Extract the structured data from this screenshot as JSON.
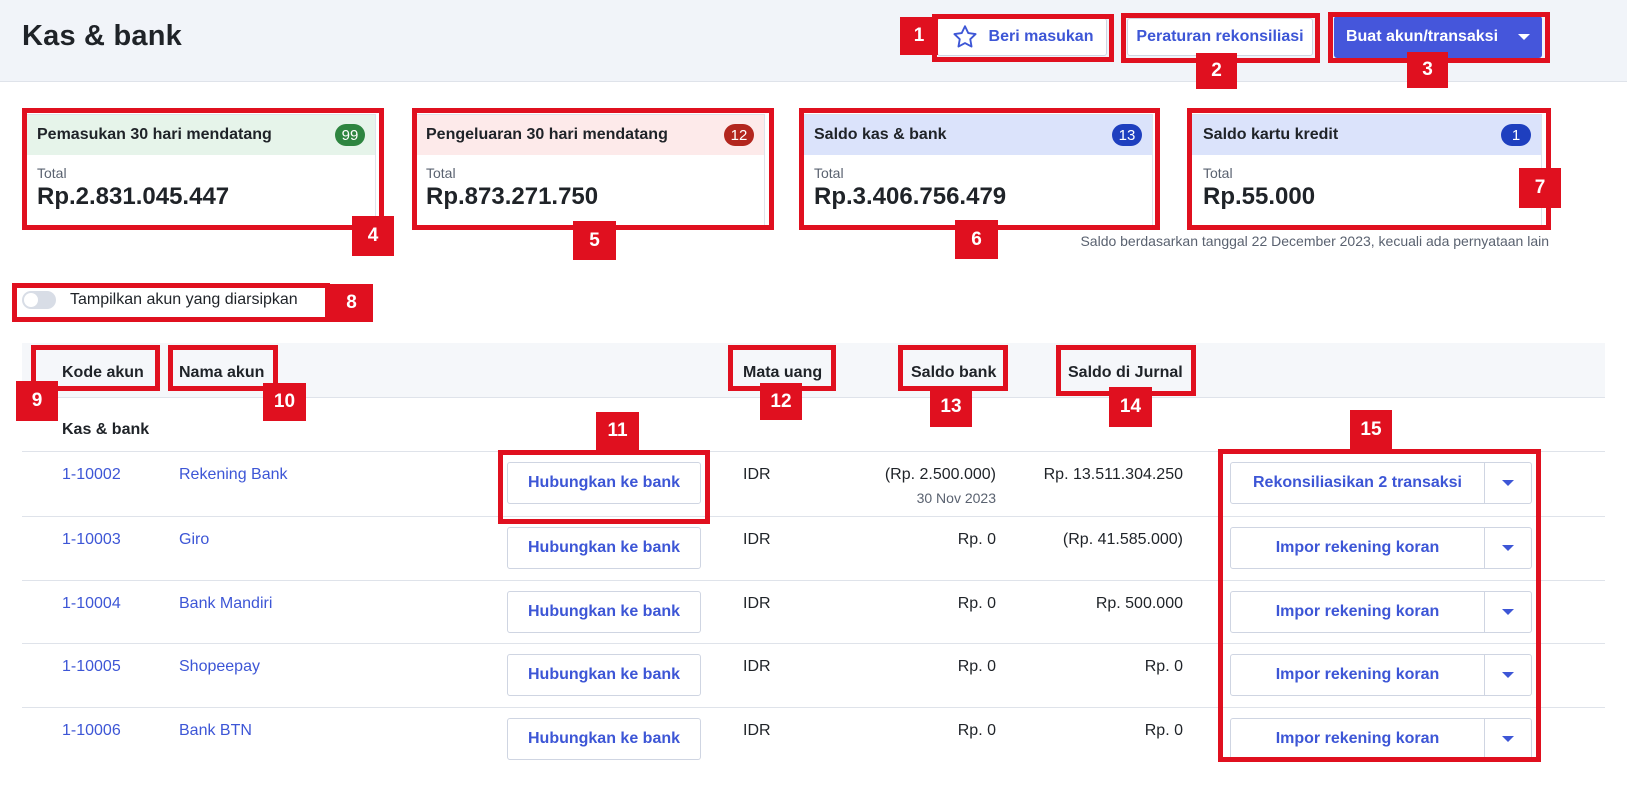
{
  "header": {
    "title": "Kas & bank",
    "feedback_label": "Beri masukan",
    "rules_label": "Peraturan rekonsiliasi",
    "create_label": "Buat akun/transaksi"
  },
  "cards": [
    {
      "title": "Pemasukan 30 hari mendatang",
      "count": "99",
      "total_label": "Total",
      "amount": "Rp.2.831.045.447",
      "head_color": "#e6f4ea",
      "count_color": "#2e8540"
    },
    {
      "title": "Pengeluaran 30 hari mendatang",
      "count": "12",
      "total_label": "Total",
      "amount": "Rp.873.271.750",
      "head_color": "#fdeaea",
      "count_color": "#b3261e"
    },
    {
      "title": "Saldo kas & bank",
      "count": "13",
      "total_label": "Total",
      "amount": "Rp.3.406.756.479",
      "head_color": "#dbe3fb",
      "count_color": "#1e3fbf"
    },
    {
      "title": "Saldo kartu kredit",
      "count": "1",
      "total_label": "Total",
      "amount": "Rp.55.000",
      "head_color": "#dbe3fb",
      "count_color": "#1e3fbf"
    }
  ],
  "balance_note": "Saldo berdasarkan tanggal 22 December 2023, kecuali ada pernyataan lain",
  "toggle_label": "Tampilkan akun yang diarsipkan",
  "table": {
    "headers": {
      "code": "Kode akun",
      "name": "Nama akun",
      "currency": "Mata uang",
      "bank_balance": "Saldo bank",
      "journal_balance": "Saldo di Jurnal"
    },
    "group": "Kas & bank",
    "connect_label": "Hubungkan ke bank",
    "rows": [
      {
        "code": "1-10002",
        "name": "Rekening Bank",
        "currency": "IDR",
        "bank_balance": "(Rp. 2.500.000)",
        "bank_date": "30 Nov 2023",
        "journal_balance": "Rp. 13.511.304.250",
        "action": "Rekonsiliasikan 2 transaksi"
      },
      {
        "code": "1-10003",
        "name": "Giro",
        "currency": "IDR",
        "bank_balance": "Rp. 0",
        "bank_date": "",
        "journal_balance": "(Rp. 41.585.000)",
        "action": "Impor rekening koran"
      },
      {
        "code": "1-10004",
        "name": "Bank Mandiri",
        "currency": "IDR",
        "bank_balance": "Rp. 0",
        "bank_date": "",
        "journal_balance": "Rp. 500.000",
        "action": "Impor rekening koran"
      },
      {
        "code": "1-10005",
        "name": "Shopeepay",
        "currency": "IDR",
        "bank_balance": "Rp. 0",
        "bank_date": "",
        "journal_balance": "Rp. 0",
        "action": "Impor rekening koran"
      },
      {
        "code": "1-10006",
        "name": "Bank BTN",
        "currency": "IDR",
        "bank_balance": "Rp. 0",
        "bank_date": "",
        "journal_balance": "Rp. 0",
        "action": "Impor rekening koran"
      }
    ]
  },
  "annotations": [
    "1",
    "2",
    "3",
    "4",
    "5",
    "6",
    "7",
    "8",
    "9",
    "10",
    "11",
    "12",
    "13",
    "14",
    "15"
  ]
}
